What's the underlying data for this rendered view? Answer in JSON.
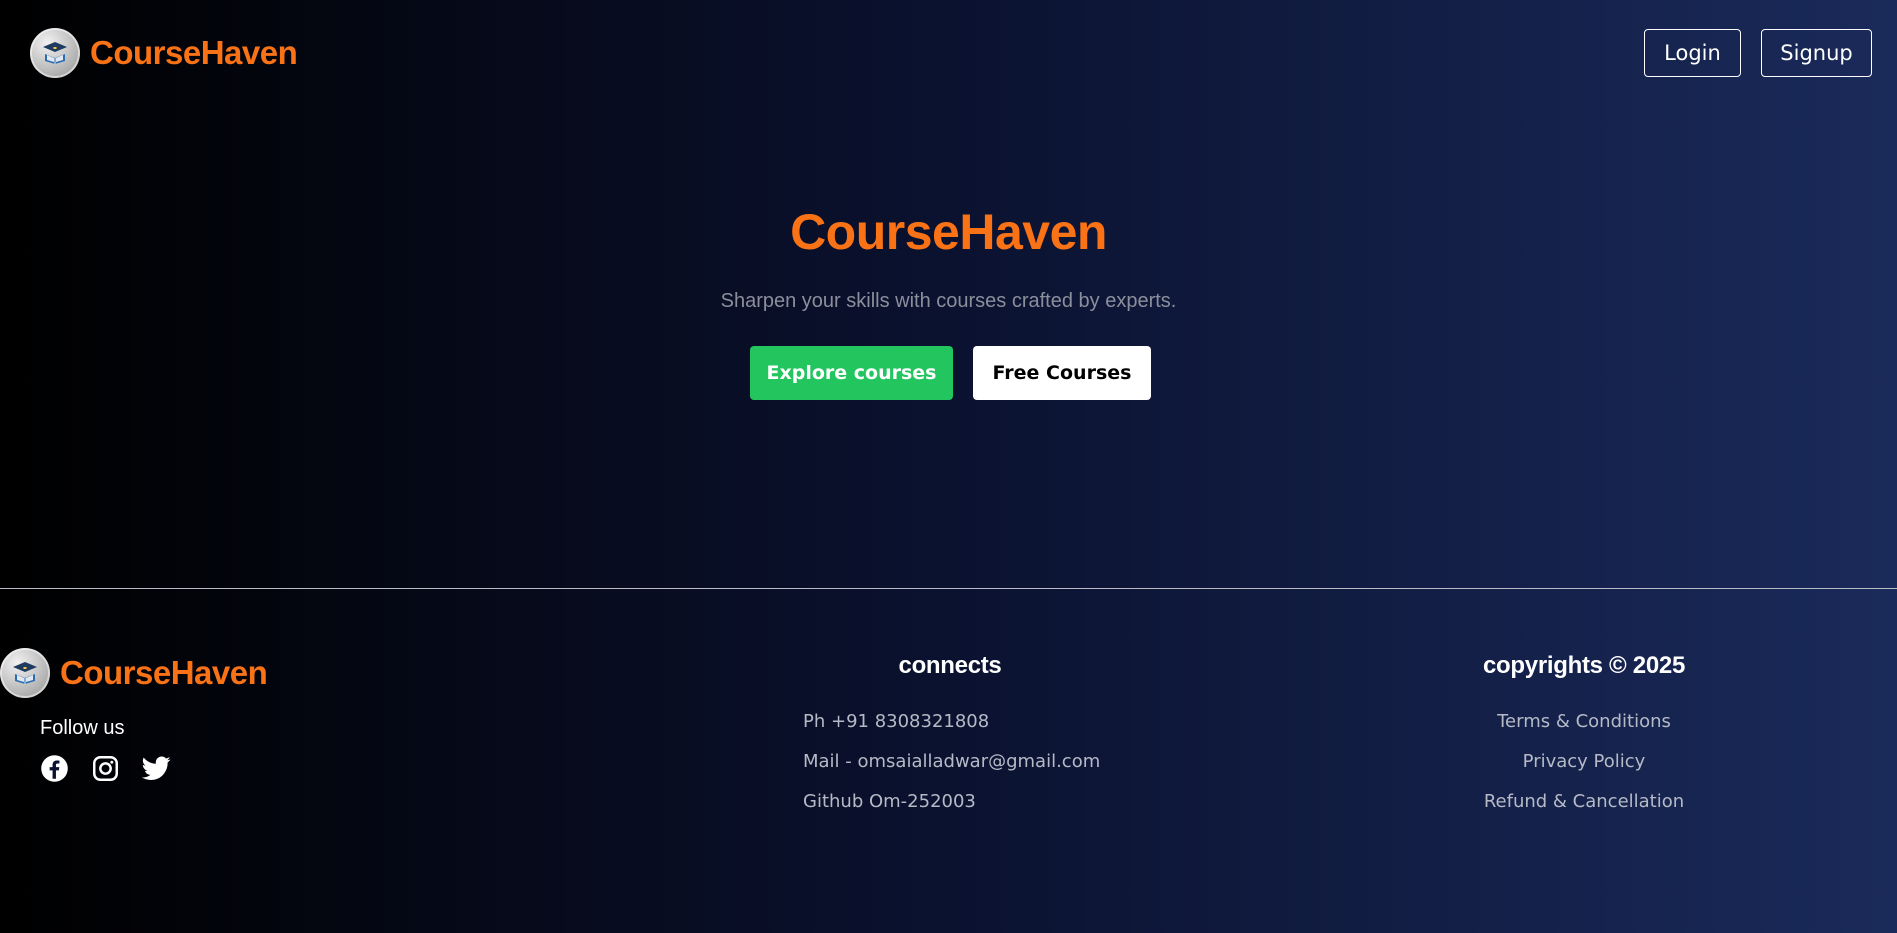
{
  "app": {
    "brand_name": "CourseHaven",
    "logo_icon": "graduation-book-icon",
    "accent_color": "#f97316"
  },
  "header": {
    "login_label": "Login",
    "signup_label": "Signup"
  },
  "hero": {
    "title": "CourseHaven",
    "subtitle": "Sharpen your skills with courses crafted by experts.",
    "explore_label": "Explore courses",
    "explore_color": "#22c55e",
    "free_label": "Free Courses"
  },
  "footer": {
    "brand_name": "CourseHaven",
    "follow_label": "Follow us",
    "social_icons": [
      "facebook-icon",
      "instagram-icon",
      "twitter-icon"
    ],
    "connects": {
      "heading": "connects",
      "items": [
        "Ph +91 8308321808",
        "Mail - omsaialladwar@gmail.com",
        "Github Om-252003"
      ]
    },
    "legal": {
      "heading": "copyrights © 2025",
      "items": [
        "Terms & Conditions",
        "Privacy Policy",
        "Refund & Cancellation"
      ]
    }
  }
}
